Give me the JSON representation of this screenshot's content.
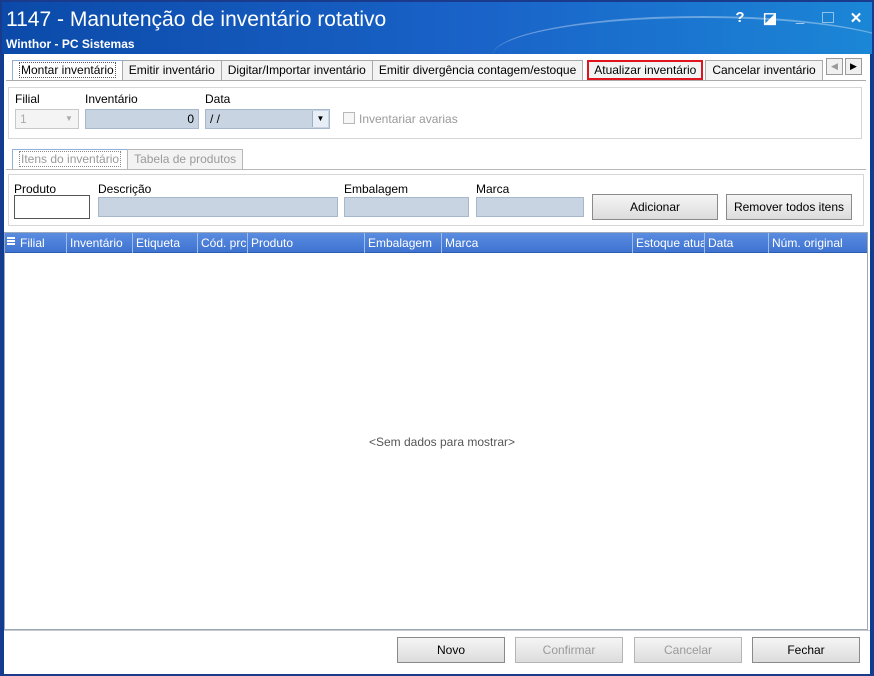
{
  "window": {
    "title": "1147 - Manutenção de inventário rotativo",
    "subtitle": "Winthor - PC Sistemas",
    "help": "?",
    "minimize": "_",
    "close": "✕"
  },
  "tabs": [
    {
      "label": "Montar inventário"
    },
    {
      "label": "Emitir inventário"
    },
    {
      "label": "Digitar/Importar inventário"
    },
    {
      "label": "Emitir divergência contagem/estoque"
    },
    {
      "label": "Atualizar inventário"
    },
    {
      "label": "Cancelar inventário"
    }
  ],
  "filters": {
    "filial_label": "Filial",
    "filial_value": "1",
    "inventario_label": "Inventário",
    "inventario_value": "0",
    "data_label": "Data",
    "data_value": "/ /",
    "avarias_label": "Inventariar avarias"
  },
  "subtabs": [
    {
      "label": "Itens do inventário"
    },
    {
      "label": "Tabela de produtos"
    }
  ],
  "product": {
    "produto_label": "Produto",
    "descricao_label": "Descrição",
    "embalagem_label": "Embalagem",
    "marca_label": "Marca",
    "add_button": "Adicionar",
    "remove_all_button": "Remover todos itens"
  },
  "grid": {
    "columns": [
      "Filial",
      "Inventário",
      "Etiqueta",
      "Cód. prc",
      "Produto",
      "Embalagem",
      "Marca",
      "Estoque atua",
      "Data",
      "Núm. original"
    ],
    "empty_text": "<Sem dados para mostrar>"
  },
  "footer": {
    "novo": "Novo",
    "confirmar": "Confirmar",
    "cancelar": "Cancelar",
    "fechar": "Fechar"
  },
  "colors": {
    "titlebar": "#1a63c8",
    "grid_header": "#4a80d8",
    "highlight": "#e0141e"
  }
}
